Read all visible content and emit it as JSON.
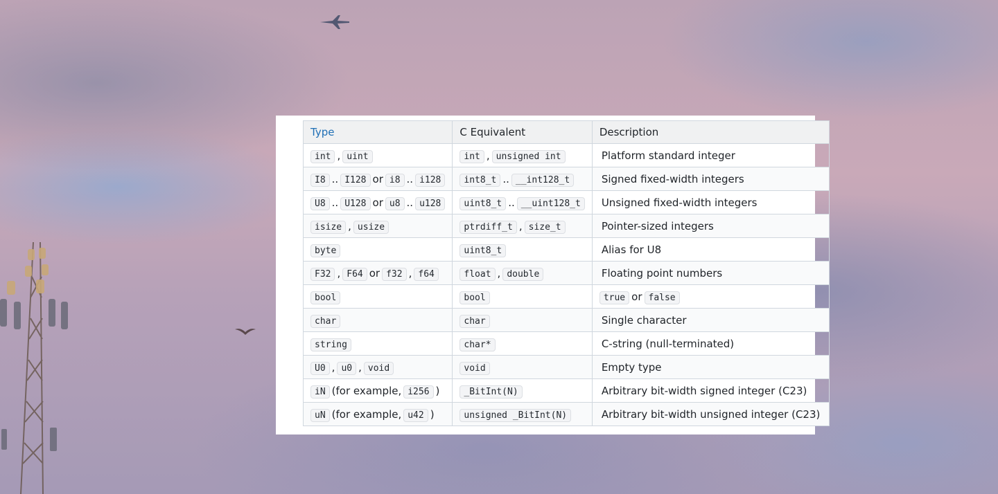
{
  "table": {
    "headers": {
      "type": "Type",
      "c_equivalent": "C Equivalent",
      "description": "Description"
    },
    "rows": [
      {
        "type": [
          {
            "code": "int"
          },
          {
            "text": ","
          },
          {
            "code": "uint"
          }
        ],
        "c": [
          {
            "code": "int"
          },
          {
            "text": ","
          },
          {
            "code": "unsigned int"
          }
        ],
        "description": [
          {
            "text": "Platform standard integer"
          }
        ]
      },
      {
        "type": [
          {
            "code": "I8"
          },
          {
            "text": ".."
          },
          {
            "code": "I128"
          },
          {
            "text": "or"
          },
          {
            "code": "i8"
          },
          {
            "text": ".."
          },
          {
            "code": "i128"
          }
        ],
        "c": [
          {
            "code": "int8_t"
          },
          {
            "text": ".."
          },
          {
            "code": "__int128_t"
          }
        ],
        "description": [
          {
            "text": "Signed fixed-width integers"
          }
        ]
      },
      {
        "type": [
          {
            "code": "U8"
          },
          {
            "text": ".."
          },
          {
            "code": "U128"
          },
          {
            "text": "or"
          },
          {
            "code": "u8"
          },
          {
            "text": ".."
          },
          {
            "code": "u128"
          }
        ],
        "c": [
          {
            "code": "uint8_t"
          },
          {
            "text": ".."
          },
          {
            "code": "__uint128_t"
          }
        ],
        "description": [
          {
            "text": "Unsigned fixed-width integers"
          }
        ]
      },
      {
        "type": [
          {
            "code": "isize"
          },
          {
            "text": ","
          },
          {
            "code": "usize"
          }
        ],
        "c": [
          {
            "code": "ptrdiff_t"
          },
          {
            "text": ","
          },
          {
            "code": "size_t"
          }
        ],
        "description": [
          {
            "text": "Pointer-sized integers"
          }
        ]
      },
      {
        "type": [
          {
            "code": "byte"
          }
        ],
        "c": [
          {
            "code": "uint8_t"
          }
        ],
        "description": [
          {
            "text": "Alias for U8"
          }
        ]
      },
      {
        "type": [
          {
            "code": "F32"
          },
          {
            "text": ","
          },
          {
            "code": "F64"
          },
          {
            "text": "or"
          },
          {
            "code": "f32"
          },
          {
            "text": ","
          },
          {
            "code": "f64"
          }
        ],
        "c": [
          {
            "code": "float"
          },
          {
            "text": ","
          },
          {
            "code": "double"
          }
        ],
        "description": [
          {
            "text": "Floating point numbers"
          }
        ]
      },
      {
        "type": [
          {
            "code": "bool"
          }
        ],
        "c": [
          {
            "code": "bool"
          }
        ],
        "description": [
          {
            "code": "true"
          },
          {
            "text": "or"
          },
          {
            "code": "false"
          }
        ]
      },
      {
        "type": [
          {
            "code": "char"
          }
        ],
        "c": [
          {
            "code": "char"
          }
        ],
        "description": [
          {
            "text": "Single character"
          }
        ]
      },
      {
        "type": [
          {
            "code": "string"
          }
        ],
        "c": [
          {
            "code": "char*"
          }
        ],
        "description": [
          {
            "text": "C-string (null-terminated)"
          }
        ]
      },
      {
        "type": [
          {
            "code": "U0"
          },
          {
            "text": ","
          },
          {
            "code": "u0"
          },
          {
            "text": ","
          },
          {
            "code": "void"
          }
        ],
        "c": [
          {
            "code": "void"
          }
        ],
        "description": [
          {
            "text": "Empty type"
          }
        ]
      },
      {
        "type": [
          {
            "code": "iN"
          },
          {
            "text": "(for example,"
          },
          {
            "code": "i256"
          },
          {
            "text": ")"
          }
        ],
        "c": [
          {
            "code": "_BitInt(N)"
          }
        ],
        "description": [
          {
            "text": "Arbitrary bit-width signed integer (C23)"
          }
        ]
      },
      {
        "type": [
          {
            "code": "uN"
          },
          {
            "text": "(for example,"
          },
          {
            "code": "u42"
          },
          {
            "text": ")"
          }
        ],
        "c": [
          {
            "code": "unsigned _BitInt(N)"
          }
        ],
        "description": [
          {
            "text": "Arbitrary bit-width unsigned integer (C23)"
          }
        ]
      }
    ]
  },
  "colors": {
    "header_link": "#1f6fb5",
    "header_bg": "#f0f1f2",
    "border": "#d0d7de",
    "code_bg": "#f3f4f6"
  }
}
